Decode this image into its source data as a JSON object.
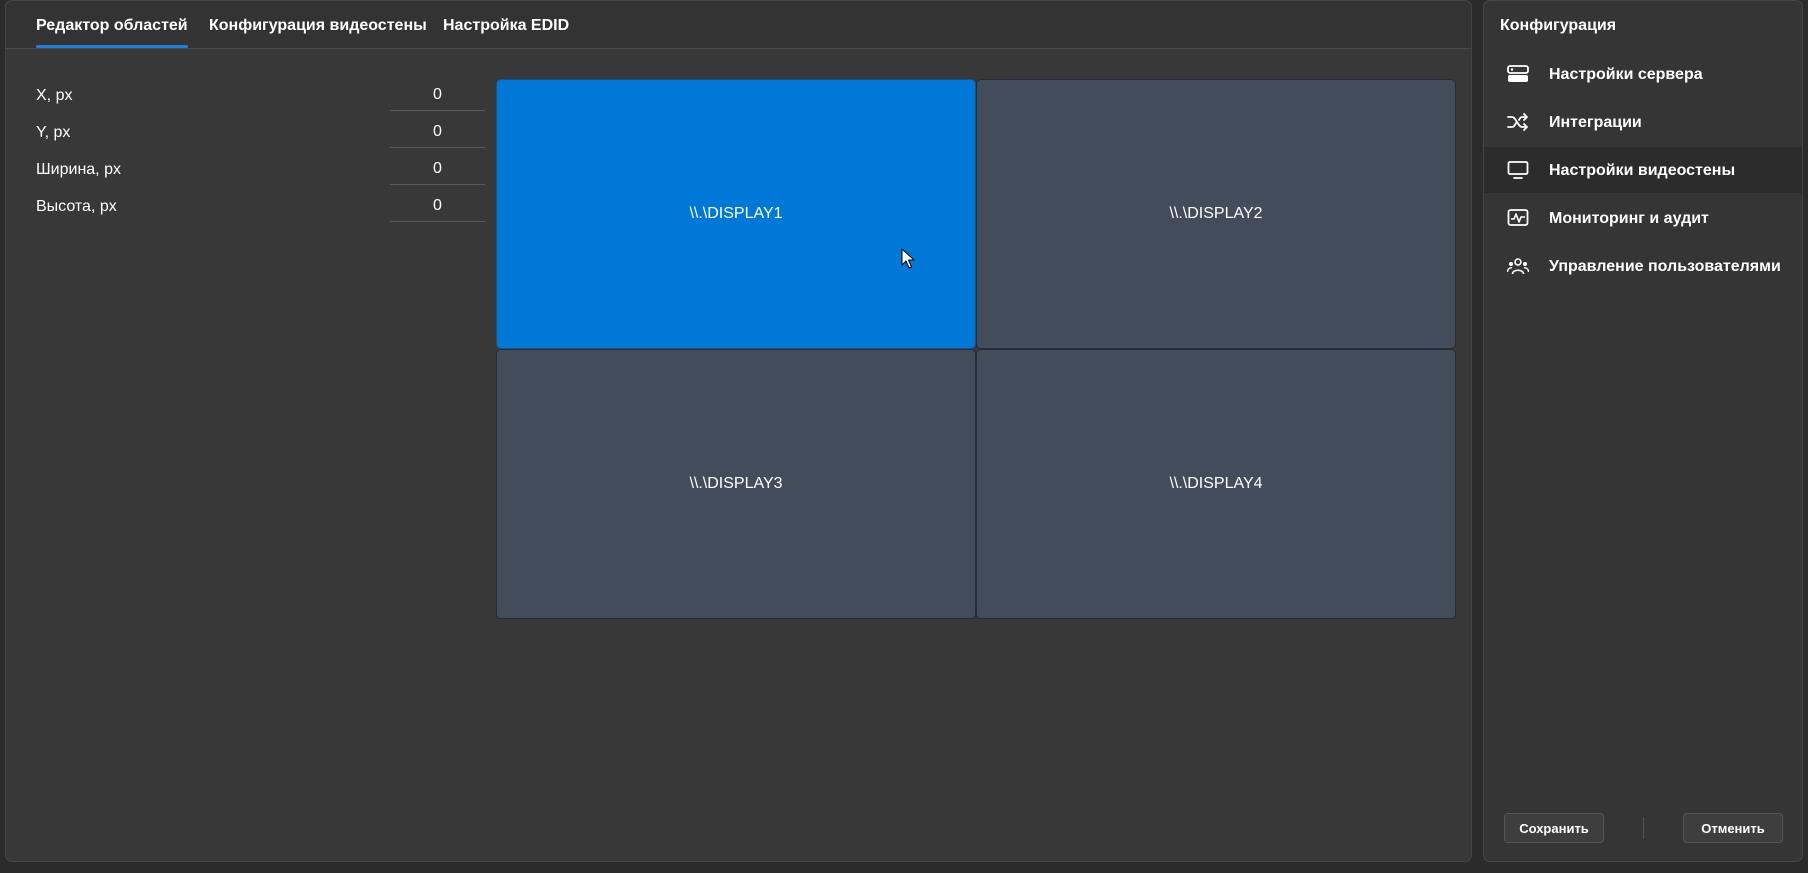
{
  "tabs": [
    {
      "label": "Редактор областей",
      "active": true
    },
    {
      "label": "Конфигурация видеостены",
      "active": false
    },
    {
      "label": "Настройка EDID",
      "active": false
    }
  ],
  "properties": [
    {
      "label": "X, px",
      "value": "0"
    },
    {
      "label": "Y, px",
      "value": "0"
    },
    {
      "label": "Ширина, px",
      "value": "0"
    },
    {
      "label": "Высота, px",
      "value": "0"
    }
  ],
  "displays": [
    {
      "name": "\\\\.\\DISPLAY1",
      "selected": true
    },
    {
      "name": "\\\\.\\DISPLAY2",
      "selected": false
    },
    {
      "name": "\\\\.\\DISPLAY3",
      "selected": false
    },
    {
      "name": "\\\\.\\DISPLAY4",
      "selected": false
    }
  ],
  "sidebar": {
    "title": "Конфигурация",
    "items": [
      {
        "label": "Настройки сервера",
        "icon": "server-icon",
        "active": false
      },
      {
        "label": "Интеграции",
        "icon": "shuffle-icon",
        "active": false
      },
      {
        "label": "Настройки видеостены",
        "icon": "monitor-icon",
        "active": true
      },
      {
        "label": "Мониторинг и аудит",
        "icon": "activity-icon",
        "active": false
      },
      {
        "label": "Управление пользователями",
        "icon": "users-icon",
        "active": false
      }
    ],
    "save_label": "Сохранить",
    "cancel_label": "Отменить"
  },
  "colors": {
    "accent": "#0078d7",
    "tab_underline": "#1e7fe0",
    "tile": "#434c5a",
    "panel": "#383838"
  }
}
